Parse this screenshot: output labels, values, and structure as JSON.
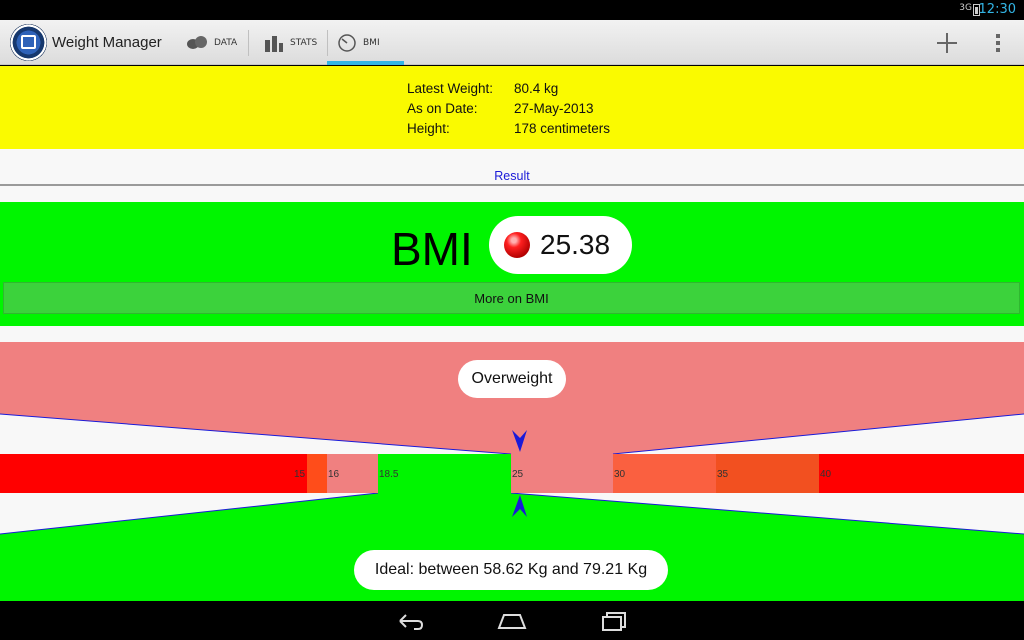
{
  "status_bar": {
    "signal": "3G",
    "time": "12:30"
  },
  "action_bar": {
    "app_title": "Weight Manager",
    "tabs": [
      {
        "label": "DATA",
        "icon": "scale-icon"
      },
      {
        "label": "STATS",
        "icon": "bar-chart-icon"
      },
      {
        "label": "BMI",
        "icon": "gauge-icon",
        "selected": true
      }
    ],
    "actions": [
      "add-icon",
      "overflow-menu-icon"
    ]
  },
  "info": {
    "rows": [
      {
        "key": "Latest Weight:",
        "value": "80.4 kg"
      },
      {
        "key": "As on Date:",
        "value": "27-May-2013"
      },
      {
        "key": "Height:",
        "value": "178 centimeters"
      }
    ]
  },
  "result": {
    "label": "Result"
  },
  "bmi": {
    "label": "BMI",
    "value": "25.38",
    "value_num": 25.38,
    "more_button": "More on BMI"
  },
  "scale": {
    "category": "Overweight",
    "ideal_text": "Ideal: between 58.62 Kg and 79.21 Kg",
    "ticks": [
      "15",
      "16",
      "18.5",
      "25",
      "30",
      "35",
      "40"
    ],
    "colors": {
      "underweight": "#ff0000",
      "mild": "#ff4d1a",
      "normal": "#00f500",
      "overweight": "#f08080",
      "obese": "#fa6040",
      "marker": "#1a1ad8"
    }
  },
  "nav_bar": {
    "buttons": [
      "back-icon",
      "home-icon",
      "recent-apps-icon"
    ]
  }
}
